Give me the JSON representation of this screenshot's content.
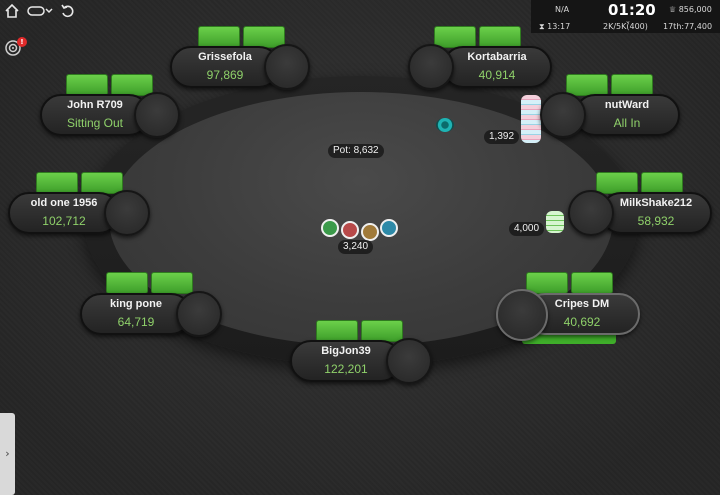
{
  "toolbar": {
    "home_icon": "home-icon",
    "menu_icon": "menu-dropdown-icon",
    "refresh_icon": "refresh-icon",
    "target_icon": "target-icon",
    "notification_badge": "!"
  },
  "info_panel": {
    "top_left": "N/A",
    "clock": "01:20",
    "prize": "856,000",
    "time_left": "13:17",
    "blinds": "2K/5K(400)",
    "position": "17th:77,400"
  },
  "pot": {
    "label": "Pot: 8,632"
  },
  "center_bet": {
    "amount": "3,240"
  },
  "seats": [
    {
      "name": "Grissefola",
      "stack": "97,869"
    },
    {
      "name": "Kortabarria",
      "stack": "40,914"
    },
    {
      "name": "John R709",
      "stack": "Sitting Out"
    },
    {
      "name": "nutWard",
      "stack": "All In"
    },
    {
      "name": "old one 1956",
      "stack": "102,712"
    },
    {
      "name": "MilkShake212",
      "stack": "58,932"
    },
    {
      "name": "king pone",
      "stack": "64,719"
    },
    {
      "name": "Cripes DM",
      "stack": "40,692"
    },
    {
      "name": "BigJon39",
      "stack": "122,201"
    }
  ],
  "bets": {
    "nutward": "1,392",
    "milkshake": "4,000"
  },
  "colors": {
    "card_back": "#4cb336",
    "stack_text": "#8fd16a",
    "dealer_button": "#1fb3b3",
    "active_bar": "#3fae2a"
  },
  "side_tab": {
    "icon": "chevron-right-icon",
    "label": "›"
  }
}
